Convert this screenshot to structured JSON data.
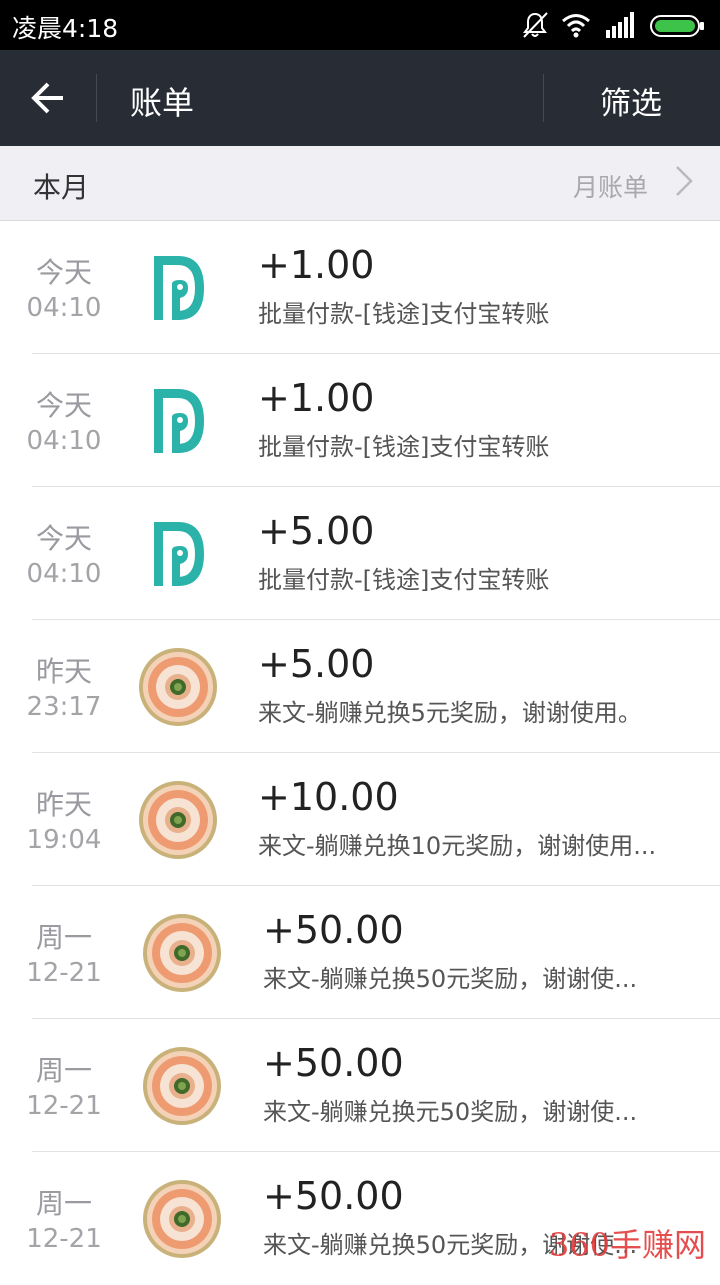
{
  "status_bar": {
    "time": "凌晨4:18",
    "icons": [
      "bell-off-icon",
      "wifi-icon",
      "signal-icon",
      "battery-icon"
    ]
  },
  "app_bar": {
    "back_icon": "arrow-left-icon",
    "title": "账单",
    "filter_label": "筛选"
  },
  "month_header": {
    "label": "本月",
    "link_label": "月账单",
    "link_icon": "chevron-right-icon"
  },
  "bills": [
    {
      "day": "今天",
      "time": "04:10",
      "avatar": "teal-d-logo",
      "amount": "+1.00",
      "desc": "批量付款-[钱途]支付宝转账"
    },
    {
      "day": "今天",
      "time": "04:10",
      "avatar": "teal-d-logo",
      "amount": "+1.00",
      "desc": "批量付款-[钱途]支付宝转账"
    },
    {
      "day": "今天",
      "time": "04:10",
      "avatar": "teal-d-logo",
      "amount": "+5.00",
      "desc": "批量付款-[钱途]支付宝转账"
    },
    {
      "day": "昨天",
      "time": "23:17",
      "avatar": "fruit-platter-photo",
      "amount": "+5.00",
      "desc": "来文-躺赚兑换5元奖励，谢谢使用。"
    },
    {
      "day": "昨天",
      "time": "19:04",
      "avatar": "fruit-platter-photo",
      "amount": "+10.00",
      "desc": "来文-躺赚兑换10元奖励，谢谢使用..."
    },
    {
      "day": "周一",
      "time": "12-21",
      "avatar": "fruit-platter-photo",
      "amount": "+50.00",
      "desc": "来文-躺赚兑换50元奖励，谢谢使..."
    },
    {
      "day": "周一",
      "time": "12-21",
      "avatar": "fruit-platter-photo",
      "amount": "+50.00",
      "desc": "来文-躺赚兑换元50奖励，谢谢使..."
    },
    {
      "day": "周一",
      "time": "12-21",
      "avatar": "fruit-platter-photo",
      "amount": "+50.00",
      "desc": "来文-躺赚兑换50元奖励，谢谢使..."
    }
  ],
  "colors": {
    "app_bar_bg": "#272c35",
    "logo_teal": "#2bb3a9",
    "header_bg": "#efeff4"
  },
  "watermark": "360手赚网"
}
